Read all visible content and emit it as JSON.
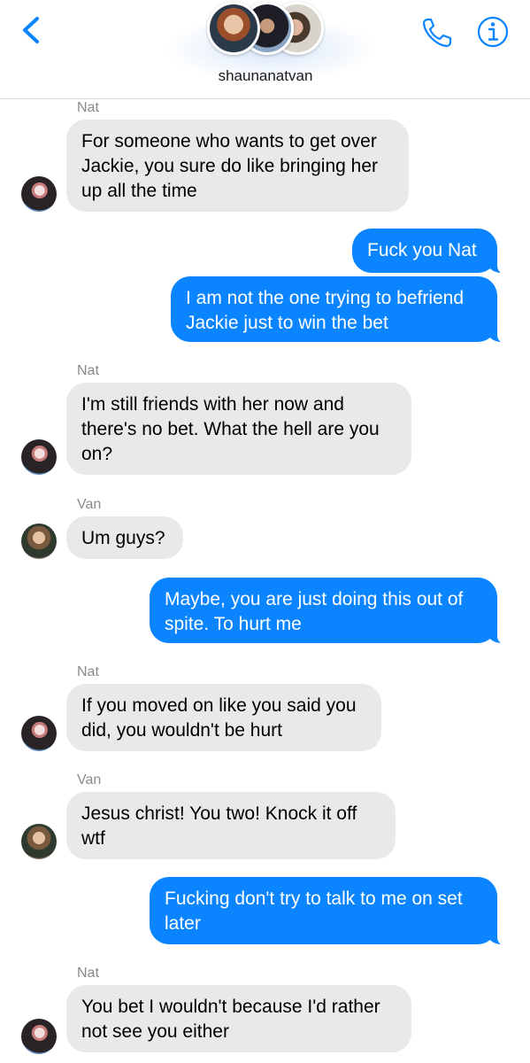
{
  "header": {
    "group_name": "shaunanatvan",
    "back_icon": "chevron-left-icon",
    "call_icon": "phone-icon",
    "info_icon": "info-icon",
    "accent": "#0a84ff"
  },
  "colors": {
    "incoming_bubble": "#e9e9eb",
    "outgoing_bubble": "#0a84ff",
    "sender_label": "#8a8a8e"
  },
  "messages": [
    {
      "sender": "Nat",
      "direction": "incoming",
      "text": "For someone who wants to get over Jackie, you sure do like bringing her up all the time"
    },
    {
      "sender": "",
      "direction": "outgoing",
      "text": "Fuck you Nat"
    },
    {
      "sender": "",
      "direction": "outgoing",
      "text": "I am not the one trying to befriend Jackie just to win the bet"
    },
    {
      "sender": "Nat",
      "direction": "incoming",
      "text": "I'm still friends with her now and there's no bet. What the hell are you on?"
    },
    {
      "sender": "Van",
      "direction": "incoming",
      "text": "Um guys?"
    },
    {
      "sender": "",
      "direction": "outgoing",
      "text": "Maybe, you are just doing this out of spite. To hurt me"
    },
    {
      "sender": "Nat",
      "direction": "incoming",
      "text": "If you moved on like you said you did, you wouldn't be hurt"
    },
    {
      "sender": "Van",
      "direction": "incoming",
      "text": "Jesus christ! You two!  Knock it off wtf"
    },
    {
      "sender": "",
      "direction": "outgoing",
      "text": "Fucking don't try to talk to me on set later"
    },
    {
      "sender": "Nat",
      "direction": "incoming",
      "text": "You bet I wouldn't because I'd rather not see you either"
    }
  ]
}
